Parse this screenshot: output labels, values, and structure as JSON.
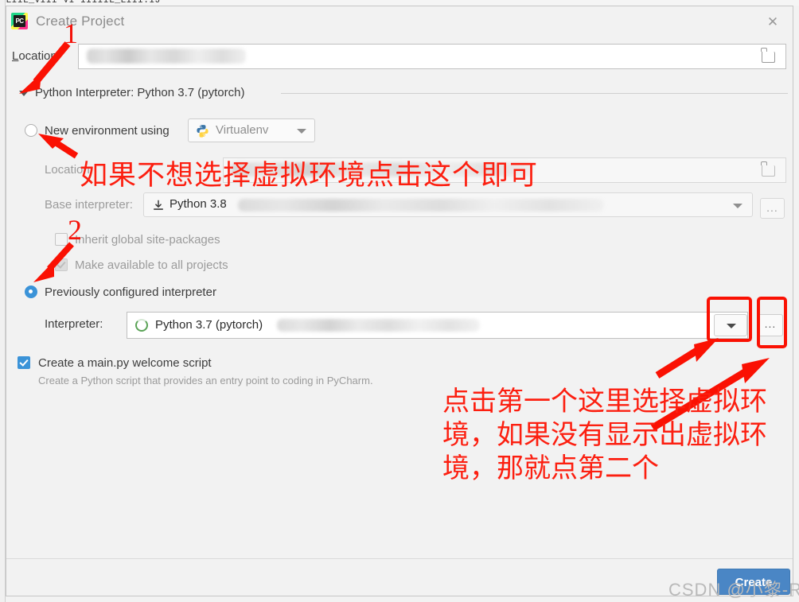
{
  "background": {
    "top_strip_text": "ILIIL_VIII  VI  IIIIIL_LIII.IJ"
  },
  "dialog": {
    "title": "Create Project",
    "close_icon": "close-icon",
    "logo_text": "PC"
  },
  "location": {
    "label": "Location:",
    "value": "",
    "browse_icon": "folder-icon"
  },
  "interpreter_section": {
    "header": "Python Interpreter: Python 3.7 (pytorch)",
    "collapse_icon": "triangle-down-icon"
  },
  "new_env": {
    "radio_label": "New environment using",
    "selected": false,
    "combo_value": "Virtualenv",
    "combo_icon": "python-icon",
    "caret_icon": "chevron-down-icon",
    "location_label": "Location:",
    "location_value": "",
    "location_browse_icon": "folder-icon",
    "base_label": "Base interpreter:",
    "base_value": "Python 3.8",
    "base_icon": "download-icon",
    "base_caret_icon": "chevron-down-icon",
    "base_dots": "...",
    "inherit_label": "Inherit global site-packages",
    "inherit_checked": false,
    "make_available_label": "Make available to all projects",
    "make_available_checked": true
  },
  "previous_env": {
    "radio_label": "Previously configured interpreter",
    "selected": true,
    "interpreter_label": "Interpreter:",
    "interpreter_value": "Python 3.7 (pytorch)",
    "interpreter_icon": "green-ring-icon",
    "caret_icon": "chevron-down-icon",
    "dots": "..."
  },
  "welcome_script": {
    "label": "Create a main.py welcome script",
    "checked": true,
    "hint": "Create a Python script that provides an entry point to coding in PyCharm."
  },
  "footer": {
    "create_label": "Create",
    "watermark": "CSDN @小黎-Rie"
  },
  "annotations": {
    "num_1": "1",
    "num_2": "2",
    "note_top": "如果不想选择虚拟环境点击这个即可",
    "note_bottom_line1": "点击第一个这里选择虚拟环",
    "note_bottom_line2": "境，如果没有显示出虚拟环",
    "note_bottom_line3": "境，那就点第二个",
    "accent_color": "#fa1103"
  }
}
